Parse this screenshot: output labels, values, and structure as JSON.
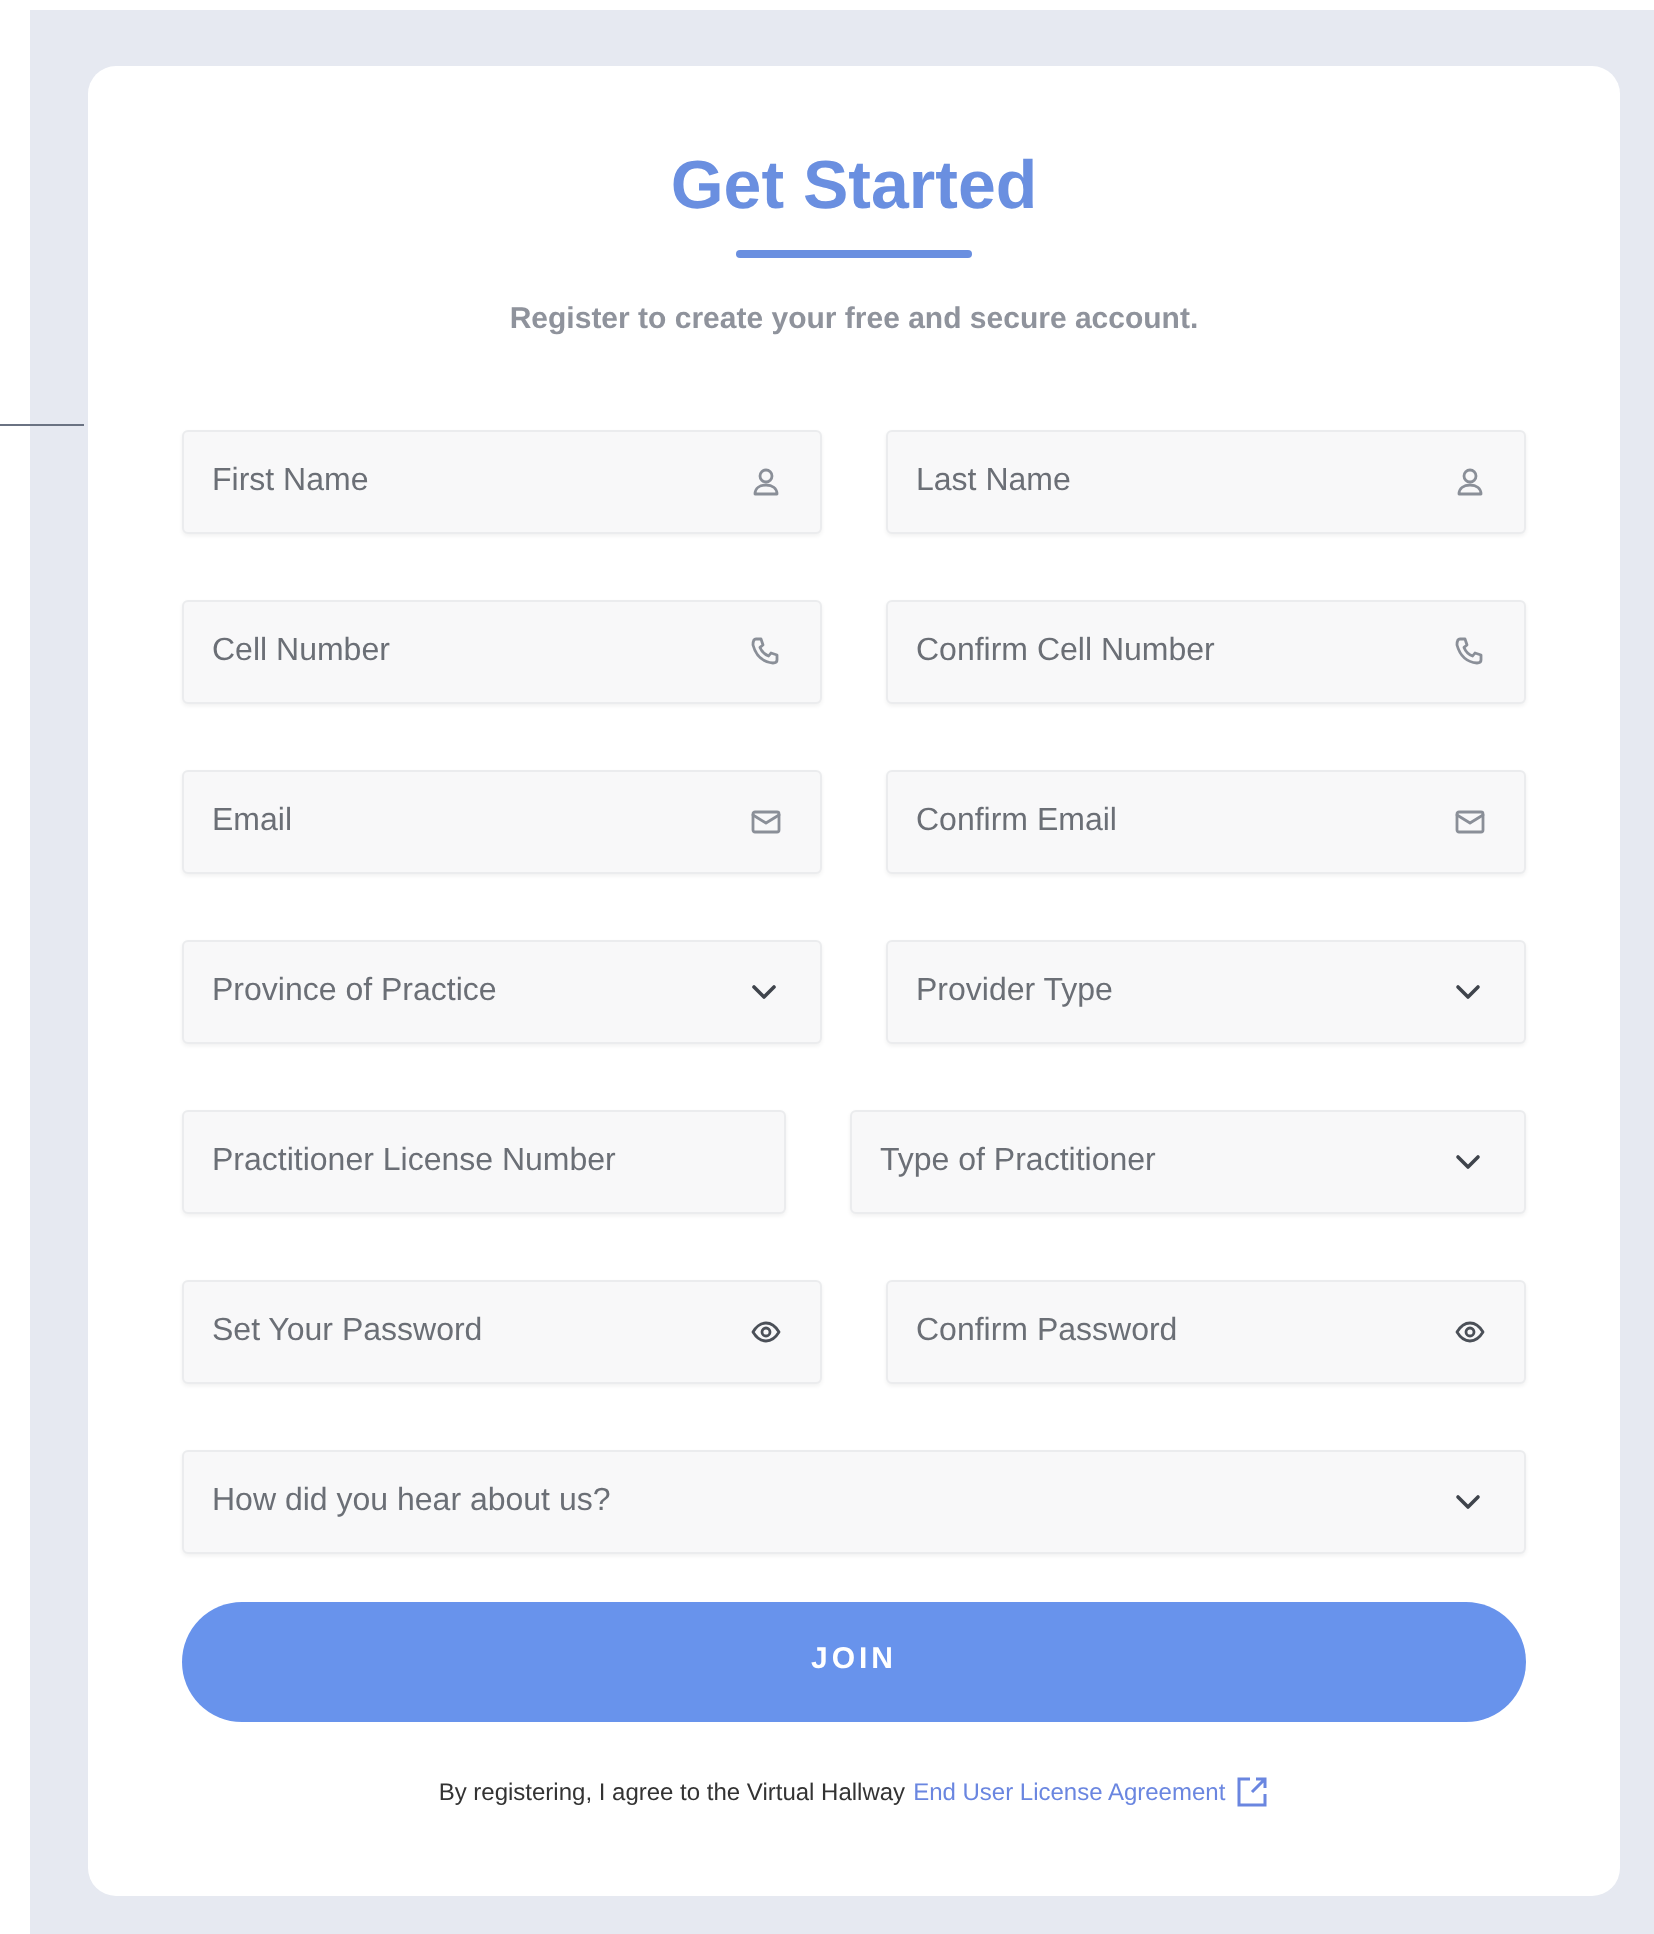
{
  "heading": {
    "title": "Get Started",
    "subtitle": "Register to create your free and secure account."
  },
  "field_rows": [
    [
      {
        "kind": "person",
        "placeholder": "First Name"
      },
      {
        "kind": "person",
        "placeholder": "Last Name"
      }
    ],
    [
      {
        "kind": "phone",
        "placeholder": "Cell Number"
      },
      {
        "kind": "phone",
        "placeholder": "Confirm Cell Number"
      }
    ],
    [
      {
        "kind": "email",
        "placeholder": "Email"
      },
      {
        "kind": "email",
        "placeholder": "Confirm Email"
      }
    ],
    [
      {
        "kind": "select",
        "placeholder": "Province of Practice"
      },
      {
        "kind": "select",
        "placeholder": "Provider Type"
      }
    ],
    [
      {
        "kind": "text",
        "placeholder": "Practitioner License Number"
      },
      {
        "kind": "select",
        "placeholder": "Type of Practitioner"
      }
    ],
    [
      {
        "kind": "password",
        "placeholder": "Set Your Password"
      },
      {
        "kind": "password",
        "placeholder": "Confirm Password"
      }
    ],
    [
      {
        "kind": "select",
        "placeholder": "How did you hear about us?"
      }
    ]
  ],
  "join_button": "JOIN",
  "agreement": {
    "text": "By registering, I agree to the Virtual Hallway",
    "link": "End User License Agreement"
  }
}
